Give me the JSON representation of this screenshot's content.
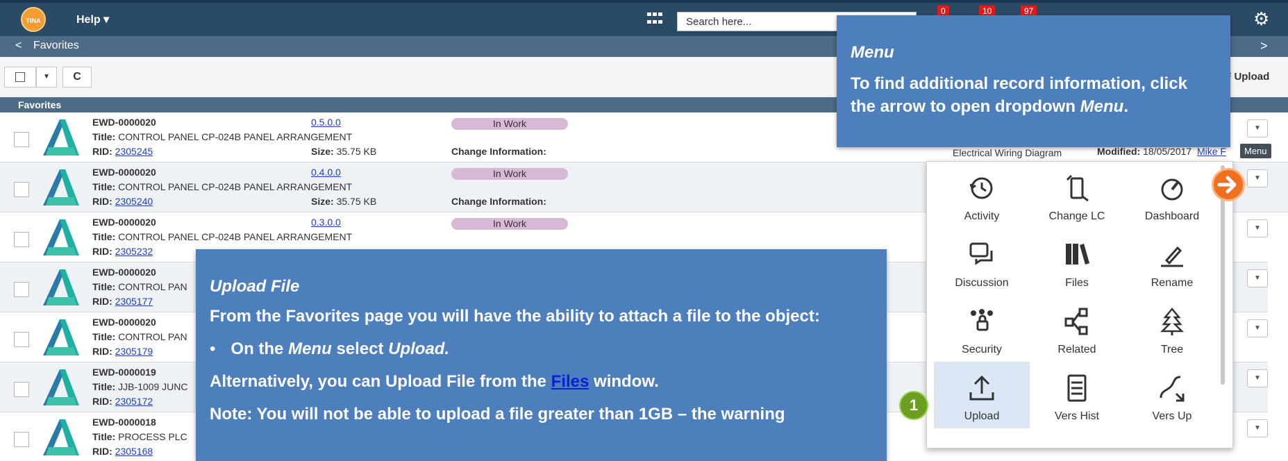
{
  "topbar": {
    "logo": "TINA",
    "help_label": "Help ▾",
    "search_placeholder": "Search here...",
    "badges": [
      "0",
      "10",
      "97"
    ]
  },
  "subbar": {
    "back_label": "<",
    "title": "Favorites",
    "forward_label": ">"
  },
  "toolbar": {
    "refresh_label": "C",
    "upload_label": "Upload"
  },
  "section": {
    "title": "Favorites"
  },
  "rows": [
    {
      "name": "EWD-0000020",
      "title": "CONTROL PANEL CP-024B PANEL ARRANGEMENT",
      "rid": "2305245",
      "version": "0.5.0.0",
      "size": "35.75 KB",
      "status": "In Work",
      "change": "Change Information:",
      "type": "Electrical Wiring Diagram",
      "modified": "18/05/2017",
      "user": "Mike F"
    },
    {
      "name": "EWD-0000020",
      "title": "CONTROL PANEL CP-024B PANEL ARRANGEMENT",
      "rid": "2305240",
      "version": "0.4.0.0",
      "size": "35.75 KB",
      "status": "In Work",
      "change": "Change Information:"
    },
    {
      "name": "EWD-0000020",
      "title": "CONTROL PANEL CP-024B PANEL ARRANGEMENT",
      "rid": "2305232",
      "version": "0.3.0.0",
      "status": "In Work"
    },
    {
      "name": "EWD-0000020",
      "title": "CONTROL PAN",
      "rid": "2305177"
    },
    {
      "name": "EWD-0000020",
      "title": "CONTROL PAN",
      "rid": "2305179"
    },
    {
      "name": "EWD-0000019",
      "title": "JJB-1009 JUNC",
      "rid": "2305172"
    },
    {
      "name": "EWD-0000018",
      "title": "PROCESS PLC",
      "rid": "2305168"
    }
  ],
  "labels": {
    "title": "Title:",
    "rid": "RID:",
    "size": "Size:",
    "modified": "Modified:"
  },
  "menu_tooltip": "Menu",
  "menu_items": [
    {
      "label": "Activity",
      "icon": "history-icon"
    },
    {
      "label": "Change LC",
      "icon": "change-lc-icon"
    },
    {
      "label": "Dashboard",
      "icon": "gauge-icon"
    },
    {
      "label": "Discussion",
      "icon": "chat-icon"
    },
    {
      "label": "Files",
      "icon": "files-icon"
    },
    {
      "label": "Rename",
      "icon": "pen-icon"
    },
    {
      "label": "Security",
      "icon": "security-icon"
    },
    {
      "label": "Related",
      "icon": "related-icon"
    },
    {
      "label": "Tree",
      "icon": "tree-icon"
    },
    {
      "label": "Upload",
      "icon": "upload-icon"
    },
    {
      "label": "Vers Hist",
      "icon": "version-history-icon"
    },
    {
      "label": "Vers Up",
      "icon": "version-up-icon"
    }
  ],
  "callout_menu": {
    "heading": "Menu",
    "text_1": "To find additional record information, click the arrow to open dropdown ",
    "text_em": "Menu",
    "text_2": "."
  },
  "callout_upload": {
    "heading": "Upload File",
    "p1": "From the Favorites page you will have the ability to attach a file to the object:",
    "bullet_1": "On the ",
    "bullet_em1": "Menu",
    "bullet_2": " select ",
    "bullet_em2": "Upload.",
    "p2_a": "Alternatively, you can Upload File from the ",
    "p2_link": "Files",
    "p2_b": " window.",
    "p3": "Note: You will not be able to upload a file greater than 1GB – the warning"
  },
  "step_number": "1",
  "colors": {
    "navbar": "#2b4a66",
    "subbar": "#4d6a86",
    "callout": "#4d7fbd",
    "status_pill": "#d7b9d6",
    "accent_orange": "#f07020",
    "step_green": "#6c9e22"
  }
}
